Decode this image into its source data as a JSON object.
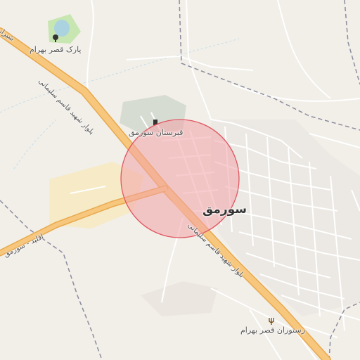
{
  "map": {
    "town_name": "سورمق",
    "roads": {
      "main_highway": "بلوار شهید قاسم سلیمانی",
      "main_highway_upper": "بلوار شهید قاسم سلیمانی",
      "top_left_highway": "شیراز",
      "left_branch": "اقلید - سورمق"
    },
    "pois": {
      "park": {
        "label": "پارک قصر بهرام",
        "icon": "tree-icon"
      },
      "cemetery": {
        "label": "قبرستان سورمق",
        "icon": "cemetery-icon"
      },
      "restaurant": {
        "label": "رستوران قصر بهرام",
        "icon": "restaurant-icon"
      }
    },
    "colors": {
      "background": "#f2efe9",
      "highway": "#f7c77e",
      "highway_casing": "#e8a94d",
      "circle_fill": "#f2a3a8",
      "circle_stroke": "#e05863",
      "boundary": "#8c8c9e",
      "water": "#aad3df",
      "park": "#c8e6b1"
    }
  }
}
